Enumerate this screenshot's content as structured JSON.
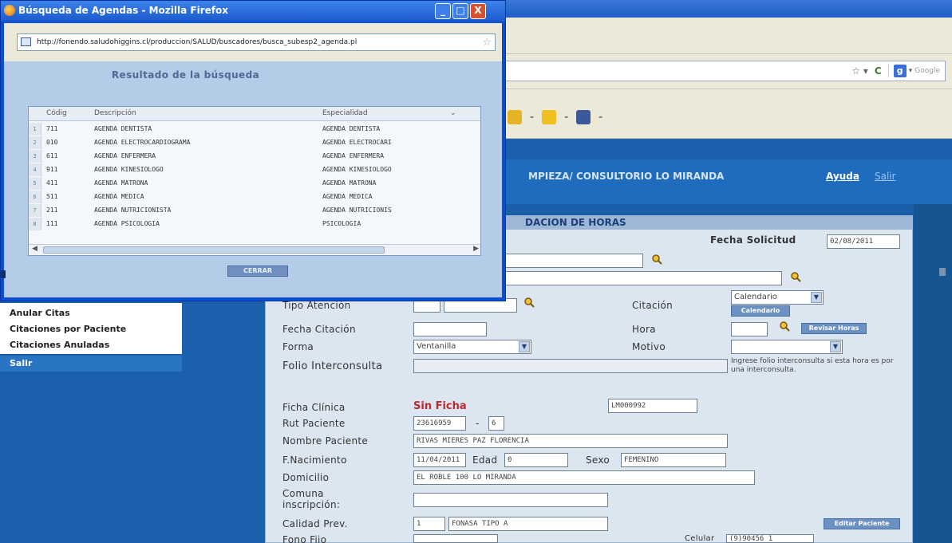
{
  "popup": {
    "title": "Búsqueda de Agendas - Mozilla Firefox",
    "window_buttons": {
      "minimize": "_",
      "maximize": "□",
      "close": "X"
    },
    "url": "http://fonendo.saludohiggins.cl/produccion/SALUD/buscadores/busca_subesp2_agenda.pl",
    "heading": "Resultado de la búsqueda",
    "columns": [
      "Códig",
      "Descripción",
      "Especialidad"
    ],
    "rows": [
      {
        "n": "1",
        "codigo": "711",
        "descripcion": "AGENDA DENTISTA",
        "especialidad": "AGENDA DENTISTA"
      },
      {
        "n": "2",
        "codigo": "010",
        "descripcion": "AGENDA ELECTROCARDIOGRAMA",
        "especialidad": "AGENDA ELECTROCARI"
      },
      {
        "n": "3",
        "codigo": "611",
        "descripcion": "AGENDA ENFERMERA",
        "especialidad": "AGENDA ENFERMERA"
      },
      {
        "n": "4",
        "codigo": "911",
        "descripcion": "AGENDA KINESIOLOGO",
        "especialidad": "AGENDA KINESIOLOGO"
      },
      {
        "n": "5",
        "codigo": "411",
        "descripcion": "AGENDA MATRONA",
        "especialidad": "AGENDA MATRONA"
      },
      {
        "n": "6",
        "codigo": "511",
        "descripcion": "AGENDA MEDICA",
        "especialidad": "AGENDA MEDICA"
      },
      {
        "n": "7",
        "codigo": "211",
        "descripcion": "AGENDA NUTRICIONISTA",
        "especialidad": "AGENDA NUTRICIONIS"
      },
      {
        "n": "8",
        "codigo": "111",
        "descripcion": "AGENDA PSICOLOGIA",
        "especialidad": "PSICOLOGIA"
      }
    ],
    "close_button": "CERRAR"
  },
  "browser": {
    "search_placeholder": "Google",
    "site_title": "MPIEZA/ CONSULTORIO LO MIRANDA",
    "help_link": "Ayuda",
    "exit_link": "Salir"
  },
  "sidebar": {
    "items": [
      "Anular Citas",
      "Citaciones por Paciente",
      "Citaciones Anuladas"
    ],
    "salir": "Salir"
  },
  "form": {
    "panel_title": "DACION DE HORAS",
    "fecha_solicitud_label": "Fecha Solicitud",
    "fecha_solicitud_value": "02/08/2011",
    "tipo_atencion_label": "Tipo Atención",
    "citacion_label": "Citación",
    "citacion_value": "Calendario",
    "calendario_button": "Calendario",
    "fecha_citacion_label": "Fecha Citación",
    "hora_label": "Hora",
    "revisar_horas_button": "Revisar Horas",
    "forma_label": "Forma",
    "forma_value": "Ventanilla",
    "motivo_label": "Motivo",
    "folio_label": "Folio Interconsulta",
    "folio_note": "Ingrese folio interconsulta si esta hora es por una interconsulta.",
    "ficha_label": "Ficha Clínica",
    "ficha_value": "Sin Ficha",
    "ficha_code": "LM000992",
    "rut_label": "Rut Paciente",
    "rut_value": "23616959",
    "rut_dv": "6",
    "nombre_label": "Nombre Paciente",
    "nombre_value": "RIVAS MIERES PAZ FLORENCIA",
    "nacimiento_label": "F.Nacimiento",
    "nacimiento_value": "11/04/2011",
    "edad_label": "Edad",
    "edad_value": "0",
    "sexo_label": "Sexo",
    "sexo_value": "FEMENINO",
    "domicilio_label": "Domicilio",
    "domicilio_value": "EL ROBLE 100 LO MIRANDA",
    "comuna_label": "Comuna inscripción:",
    "calidad_label": "Calidad Prev.",
    "calidad_code": "1",
    "calidad_value": "FONASA TIPO A",
    "editar_button": "Editar Paciente",
    "fono_label": "Fono Fijo",
    "celular_label": "Celular",
    "celular_value": "(9)90456 1"
  }
}
